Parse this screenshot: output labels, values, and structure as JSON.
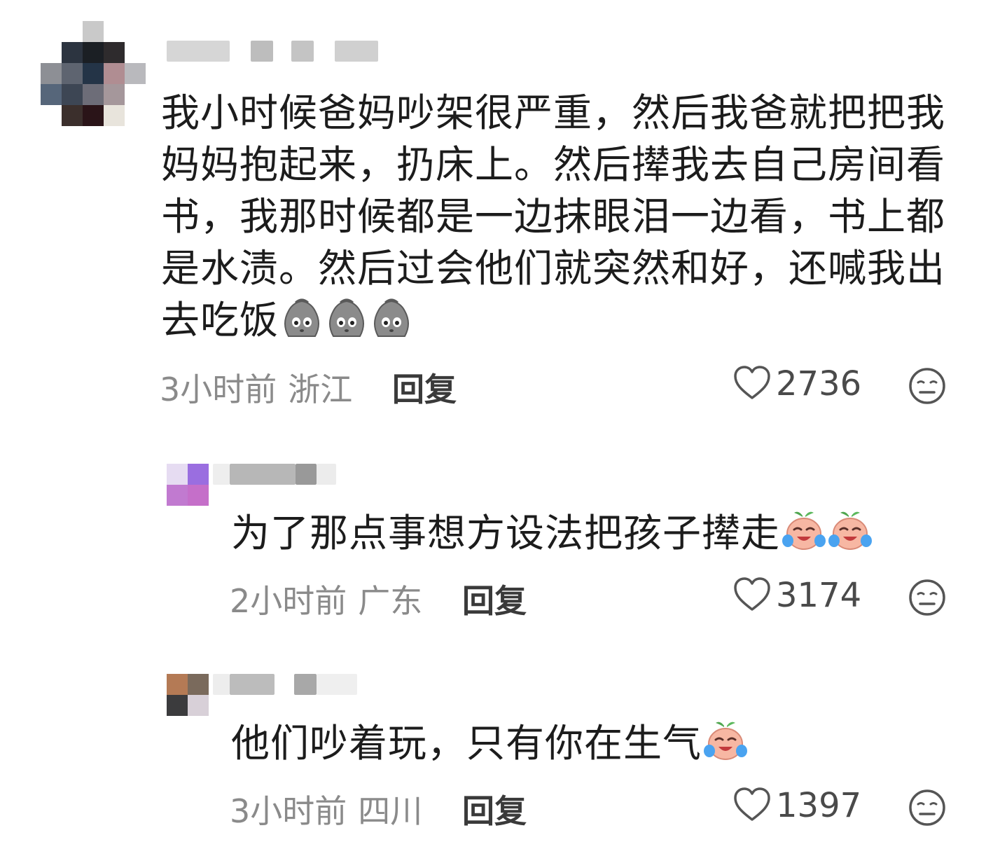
{
  "comments": [
    {
      "text_lines": [
        "我小时候爸妈吵架很严重，然后我爸就把把我",
        "妈妈抱起来，扔床上。然后撵我去自己房间看",
        "书，我那时候都是一边抹眼泪一边看，书上都",
        "是水渍。然后过会他们就突然和好，还喊我出",
        "去吃饭"
      ],
      "emojis": [
        "sack-face-emoji",
        "sack-face-emoji",
        "sack-face-emoji"
      ],
      "time": "3小时前",
      "location": "浙江",
      "reply_label": "回复",
      "likes": "2736"
    },
    {
      "text_lines": [
        "为了那点事想方设法把孩子撵走"
      ],
      "emojis": [
        "crying-peach-emoji",
        "crying-peach-emoji"
      ],
      "time": "2小时前",
      "location": "广东",
      "reply_label": "回复",
      "likes": "3174"
    },
    {
      "text_lines": [
        "他们吵着玩，只有你在生气"
      ],
      "emojis": [
        "crying-peach-emoji"
      ],
      "time": "3小时前",
      "location": "四川",
      "reply_label": "回复",
      "likes": "1397"
    }
  ],
  "colors": {
    "meta_gray": "#8a8a8a",
    "text": "#1c1c1c",
    "icon": "#555555"
  }
}
